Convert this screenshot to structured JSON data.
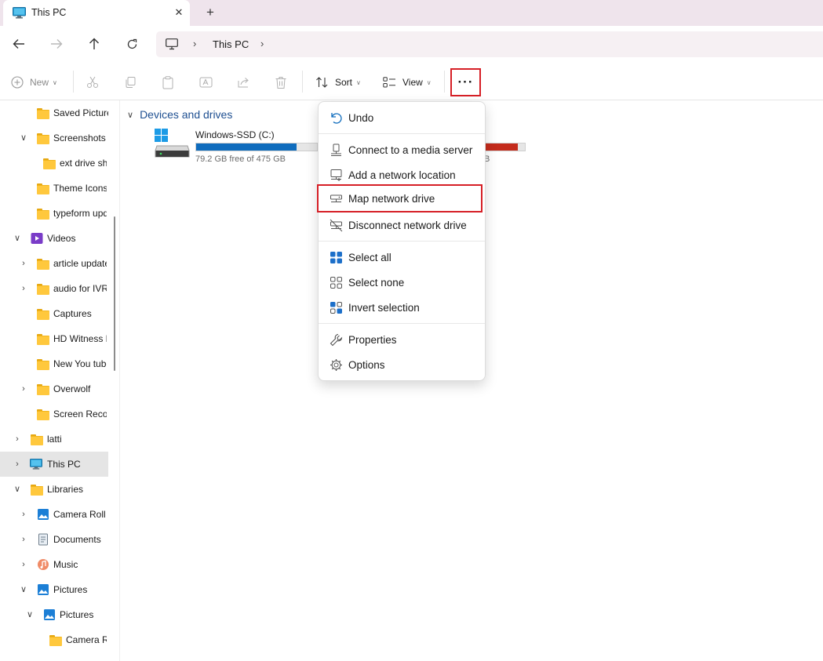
{
  "window": {
    "tab_title": "This PC",
    "tab_close": "✕",
    "new_tab": "+"
  },
  "nav": {
    "back_icon": "arrow-left-icon",
    "forward_icon": "arrow-right-icon",
    "up_icon": "arrow-up-icon",
    "refresh_icon": "refresh-icon",
    "breadcrumb": [
      "This PC"
    ],
    "separator": "›"
  },
  "toolbar": {
    "new_label": "New",
    "sort_label": "Sort",
    "view_label": "View",
    "more_label": "···",
    "disabled_icons": [
      "cut-icon",
      "copy-icon",
      "paste-icon",
      "rename-icon",
      "share-icon",
      "delete-icon"
    ]
  },
  "sidebar": {
    "items": [
      {
        "label": "Saved Pictures",
        "chevron": "",
        "icon": "folder"
      },
      {
        "label": "Screenshots",
        "chevron": "∨",
        "icon": "folder"
      },
      {
        "label": "ext drive shots",
        "chevron": "",
        "icon": "folder"
      },
      {
        "label": "Theme Icons",
        "chevron": "",
        "icon": "folder"
      },
      {
        "label": "typeform updates",
        "chevron": "",
        "icon": "folder"
      },
      {
        "label": "Videos",
        "chevron": "∨",
        "icon": "videos"
      },
      {
        "label": "article updates",
        "chevron": "›",
        "icon": "folder"
      },
      {
        "label": "audio for IVR",
        "chevron": "›",
        "icon": "folder"
      },
      {
        "label": "Captures",
        "chevron": "",
        "icon": "folder"
      },
      {
        "label": "HD Witness Media",
        "chevron": "",
        "icon": "folder"
      },
      {
        "label": "New You tube",
        "chevron": "",
        "icon": "folder"
      },
      {
        "label": "Overwolf",
        "chevron": "›",
        "icon": "folder"
      },
      {
        "label": "Screen Recordings",
        "chevron": "",
        "icon": "folder"
      },
      {
        "label": "latti",
        "chevron": "›",
        "icon": "folder"
      },
      {
        "label": "This PC",
        "chevron": "›",
        "icon": "pc"
      },
      {
        "label": "Libraries",
        "chevron": "∨",
        "icon": "folder"
      },
      {
        "label": "Camera Roll",
        "chevron": "›",
        "icon": "pictures"
      },
      {
        "label": "Documents",
        "chevron": "›",
        "icon": "documents"
      },
      {
        "label": "Music",
        "chevron": "›",
        "icon": "music"
      },
      {
        "label": "Pictures",
        "chevron": "∨",
        "icon": "pictures"
      },
      {
        "label": "Pictures",
        "chevron": "∨",
        "icon": "pictures"
      },
      {
        "label": "Camera Roll",
        "chevron": "",
        "icon": "folder"
      }
    ],
    "selected_label": "This PC"
  },
  "content": {
    "section_title": "Devices and drives",
    "section_chevron": "∨",
    "drives": [
      {
        "name": "Windows-SSD (C:)",
        "free_text": "79.2 GB free of 475 GB",
        "used_fraction": 0.833,
        "bar_color": "#0f6cbd"
      },
      {
        "name": "",
        "free_text": "B",
        "used_fraction": 0.82,
        "bar_color": "#c42b1c"
      }
    ]
  },
  "menu": {
    "items": [
      {
        "label": "Undo",
        "icon": "undo-icon"
      },
      {
        "label": "Connect to a media server",
        "icon": "media-server-icon"
      },
      {
        "label": "Add a network location",
        "icon": "network-location-icon"
      },
      {
        "label": "Map network drive",
        "icon": "map-network-drive-icon"
      },
      {
        "label": "Disconnect network drive",
        "icon": "disconnect-network-drive-icon"
      },
      {
        "label": "Select all",
        "icon": "select-all-icon"
      },
      {
        "label": "Select none",
        "icon": "select-none-icon"
      },
      {
        "label": "Invert selection",
        "icon": "invert-selection-icon"
      },
      {
        "label": "Properties",
        "icon": "wrench-icon"
      },
      {
        "label": "Options",
        "icon": "gear-icon"
      }
    ]
  },
  "colors": {
    "highlight_box": "#d61f26",
    "accent": "#0f6cbd",
    "section_title": "#1e4f91"
  }
}
